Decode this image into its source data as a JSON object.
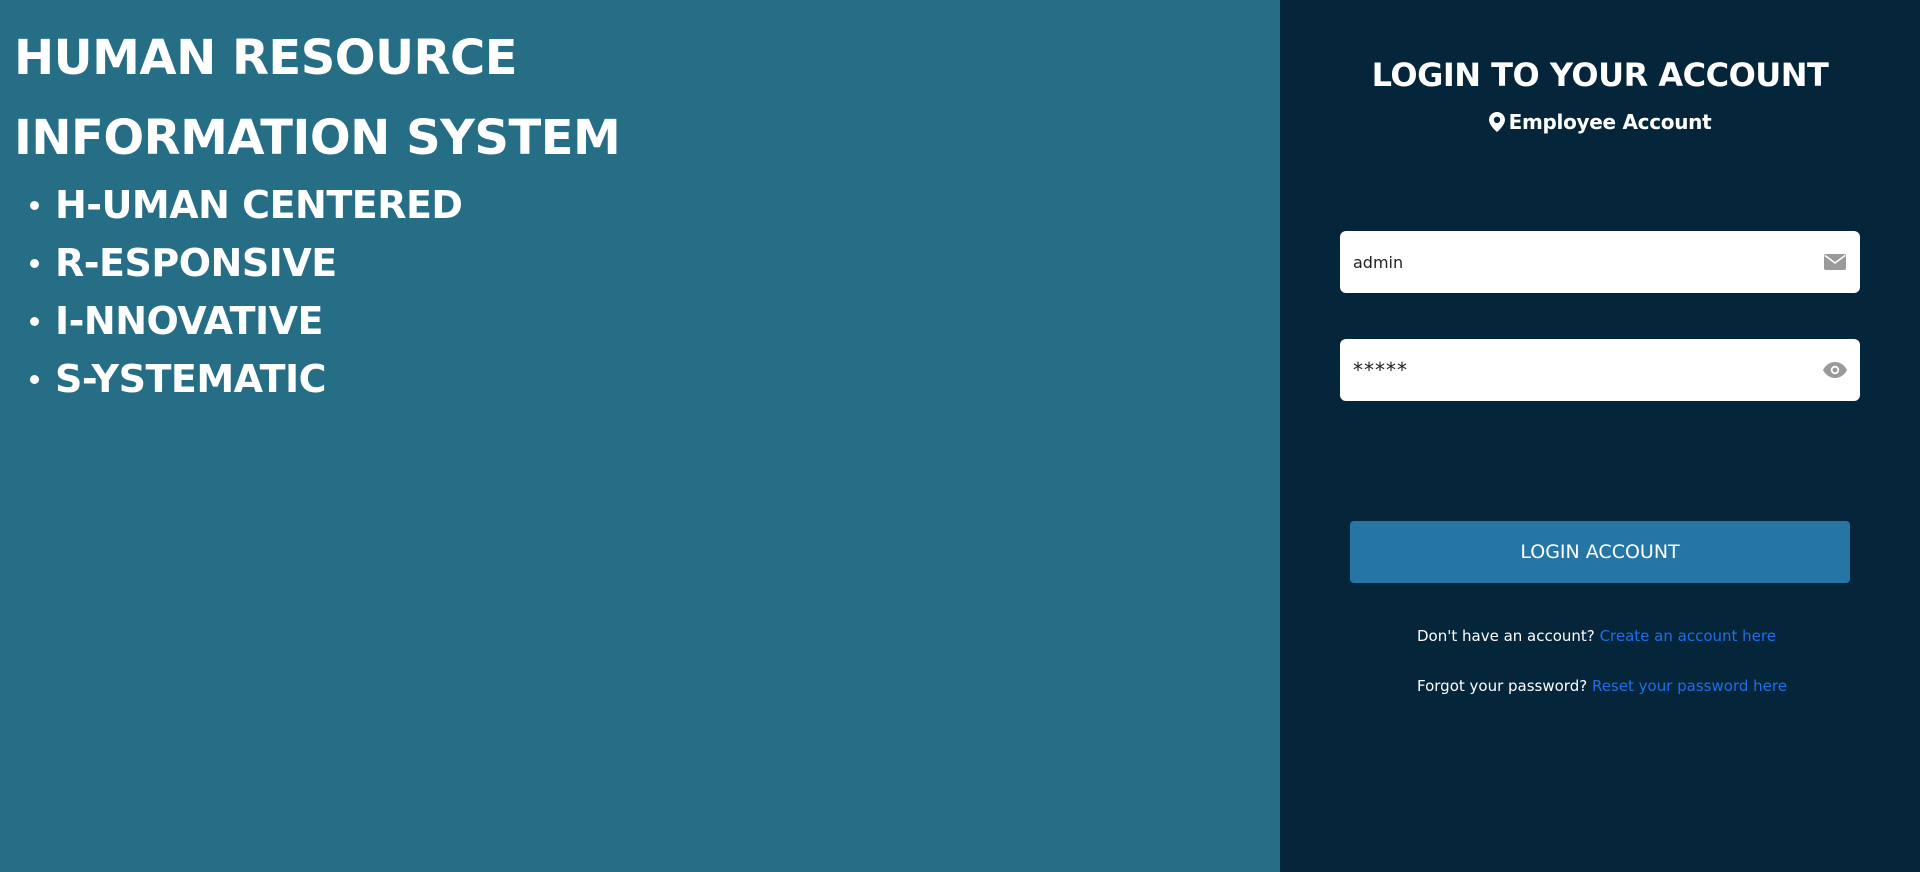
{
  "colors": {
    "left_background": "#266e86",
    "right_background": "#05253a",
    "button_background": "#2676a5",
    "link": "#1e6fe8"
  },
  "hero": {
    "title_line1": "HUMAN RESOURCE",
    "title_line2": "INFORMATION SYSTEM",
    "acronym_items": [
      "H-UMAN CENTERED",
      "R-ESPONSIVE",
      "I-NNOVATIVE",
      "S-YSTEMATIC"
    ]
  },
  "login": {
    "title": "LOGIN TO YOUR ACCOUNT",
    "account_type": "Employee Account",
    "account_type_icon": "map-marker-icon",
    "email_value": "admin",
    "email_icon": "envelope-icon",
    "password_value": "*****",
    "password_icon": "eye-icon",
    "button_label": "LOGIN ACCOUNT",
    "signup_prompt": "Don't have an account?",
    "signup_link": "Create an account here",
    "reset_prompt": "Forgot your password?",
    "reset_link": "Reset your password here"
  }
}
